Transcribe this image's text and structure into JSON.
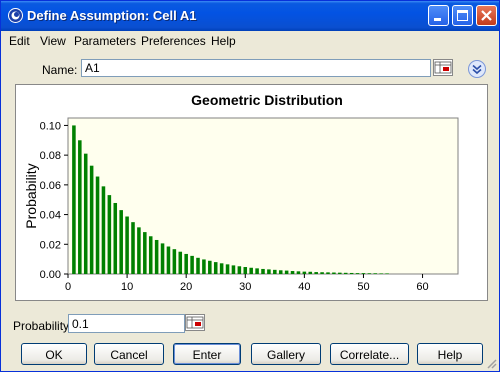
{
  "window": {
    "title": "Define Assumption: Cell A1"
  },
  "menu": {
    "items": [
      "Edit",
      "View",
      "Parameters",
      "Preferences",
      "Help"
    ]
  },
  "name_field": {
    "label": "Name:",
    "value": "A1"
  },
  "probability_field": {
    "label": "Probability",
    "value": "0.1"
  },
  "buttons": {
    "ok": "OK",
    "cancel": "Cancel",
    "enter": "Enter",
    "gallery": "Gallery",
    "correlate": "Correlate...",
    "help": "Help"
  },
  "colors": {
    "bar": "#008000",
    "plot_bg": "#ffffee",
    "title_bar": "#0a5ae0"
  },
  "chart_data": {
    "type": "bar",
    "title": "Geometric Distribution",
    "xlabel": "",
    "ylabel": "Probability",
    "xlim": [
      0,
      66
    ],
    "ylim": [
      0,
      0.105
    ],
    "xticks": [
      "0",
      "10",
      "20",
      "30",
      "40",
      "50",
      "60"
    ],
    "yticks": [
      "0.00",
      "0.02",
      "0.04",
      "0.06",
      "0.08",
      "0.10"
    ],
    "grid": false,
    "distribution": "geometric",
    "probability": 0.1,
    "x": [
      1,
      2,
      3,
      4,
      5,
      6,
      7,
      8,
      9,
      10,
      11,
      12,
      13,
      14,
      15,
      16,
      17,
      18,
      19,
      20,
      21,
      22,
      23,
      24,
      25,
      26,
      27,
      28,
      29,
      30,
      31,
      32,
      33,
      34,
      35,
      36,
      37,
      38,
      39,
      40,
      41,
      42,
      43,
      44,
      45,
      46,
      47,
      48,
      49,
      50,
      51,
      52,
      53,
      54
    ],
    "values": [
      0.1,
      0.09,
      0.081,
      0.0729,
      0.0656,
      0.059,
      0.0531,
      0.0478,
      0.043,
      0.0387,
      0.0349,
      0.0314,
      0.0282,
      0.0254,
      0.0229,
      0.0206,
      0.0185,
      0.0167,
      0.015,
      0.0135,
      0.0122,
      0.0109,
      0.0098,
      0.0089,
      0.008,
      0.0072,
      0.0065,
      0.0058,
      0.0052,
      0.0047,
      0.0042,
      0.0038,
      0.0034,
      0.0031,
      0.0028,
      0.0025,
      0.0023,
      0.002,
      0.0018,
      0.0016,
      0.0015,
      0.0013,
      0.0012,
      0.0011,
      0.001,
      0.0009,
      0.0008,
      0.0007,
      0.0006,
      0.0006,
      0.0005,
      0.0005,
      0.0004,
      0.0004
    ]
  }
}
